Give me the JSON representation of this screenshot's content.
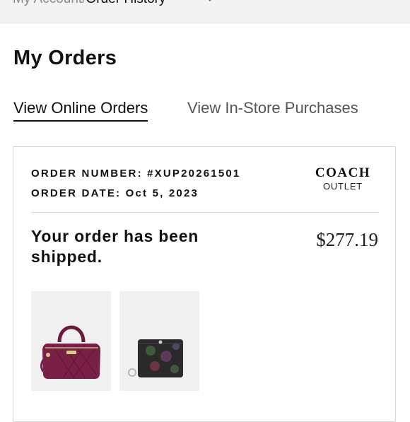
{
  "breadcrumb": {
    "parent": "My Account/",
    "current": "Order History"
  },
  "page": {
    "title": "My Orders"
  },
  "tabs": [
    {
      "label": "View Online Orders",
      "active": true
    },
    {
      "label": "View In-Store Purchases",
      "active": false
    }
  ],
  "order": {
    "number_label": "ORDER NUMBER: #XUP20261501",
    "date_label": "ORDER DATE: Oct 5, 2023",
    "brand": {
      "name": "COACH",
      "sub": "OUTLET"
    },
    "status": "Your order has been shipped.",
    "total": "$277.19",
    "items": [
      {
        "icon": "handbag-product-image",
        "color": "#7a1f45"
      },
      {
        "icon": "wallet-product-image",
        "color": "#2a2a2a"
      }
    ]
  },
  "colors": {
    "accent": "#111111",
    "muted": "#555555",
    "border": "#d4d4d4"
  }
}
